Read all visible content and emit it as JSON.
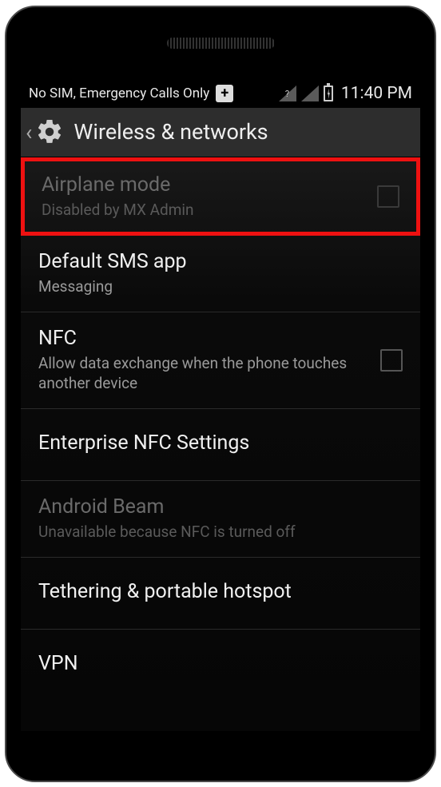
{
  "status": {
    "left_text": "No SIM, Emergency Calls Only",
    "plus_label": "+",
    "clock": "11:40 PM"
  },
  "header": {
    "title": "Wireless & networks"
  },
  "rows": {
    "airplane": {
      "title": "Airplane mode",
      "sub": "Disabled by MX Admin"
    },
    "sms": {
      "title": "Default SMS app",
      "sub": "Messaging"
    },
    "nfc": {
      "title": "NFC",
      "sub": "Allow data exchange when the phone touches another device"
    },
    "ent_nfc": {
      "title": "Enterprise NFC Settings"
    },
    "beam": {
      "title": "Android Beam",
      "sub": "Unavailable because NFC is turned off"
    },
    "tether": {
      "title": "Tethering & portable hotspot"
    },
    "vpn": {
      "title": "VPN"
    }
  }
}
